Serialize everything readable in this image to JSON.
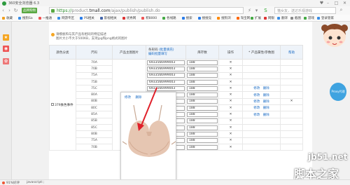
{
  "titlebar": {
    "title": "360安全浏览器 6.3"
  },
  "addressbar": {
    "site_badge": "品牌购物",
    "url_scheme": "https://",
    "url_subdomain": "product.",
    "url_domain": "tmall.com",
    "url_path": "/ajax/publish/publish.do",
    "search_placeholder": "猫女友，送达乐视游戏"
  },
  "bookmarks": [
    {
      "label": "收藏",
      "color": "#f0a020"
    },
    {
      "label": "搜狗Sa",
      "color": "#3a8ee6"
    },
    {
      "label": "一推通",
      "color": "#e55"
    },
    {
      "label": "网游专区",
      "color": "#3a8ee6"
    },
    {
      "label": "PS相关",
      "color": "#2b7de9"
    },
    {
      "label": "影视相关",
      "color": "#46a"
    },
    {
      "label": "优秀网",
      "color": "#d33"
    },
    {
      "label": "积8000",
      "color": "#e55"
    },
    {
      "label": "各线路",
      "color": "#4a4"
    },
    {
      "label": "搜索",
      "color": "#2b7de9"
    },
    {
      "label": "搜搜竞",
      "color": "#2b7de9"
    },
    {
      "label": "搜狗浏",
      "color": "#f80"
    },
    {
      "label": "淘宝网",
      "color": "#f60"
    }
  ],
  "bookmarks_right": [
    {
      "label": "扩展",
      "color": "#4a4"
    },
    {
      "label": "网银",
      "color": "#d33"
    },
    {
      "label": "翻译",
      "color": "#3a8ee6"
    },
    {
      "label": "截图",
      "color": "#888"
    },
    {
      "label": "游戏",
      "color": "#4a4"
    },
    {
      "label": "登录管家",
      "color": "#3a8ee6"
    }
  ],
  "notice": {
    "line1": "请模板和与其产品有相同的特征描述",
    "line2": "图片大小不大于500KB，支持jpg和png格式的图片"
  },
  "table": {
    "headers": {
      "color_category": "颜色分类",
      "size": "尺码",
      "image": "产品主图图片",
      "price_tag_line1": "条形码",
      "price_tag_line2": "(批量填充)",
      "price_tag_line3": "编码批量填写",
      "stock": "库存数",
      "action": "操作",
      "attrs": "* 产品属性/参数图",
      "attrs_help": "帮助",
      "action2": "操作"
    },
    "barcode_value": "6933566999003",
    "stock_value": "188",
    "delete_symbol": "✕",
    "row_label": "379肤色事件",
    "edit_link": "修改",
    "delete_link": "删除",
    "sizes": [
      "70A",
      "70B",
      "75A",
      "75B",
      "75C",
      "80A",
      "80B",
      "80C",
      "85A",
      "85B",
      "85C",
      "80B",
      "75A",
      "70B"
    ]
  },
  "popup": {
    "edit_link": "修改",
    "delete_link": "删除"
  },
  "proxy_badge": "Proxy代理",
  "watermark": {
    "line1": "jb51.net",
    "line2": "脚本之家"
  },
  "statusbar": {
    "zoom": "91%好评",
    "script": "javascript:;"
  }
}
